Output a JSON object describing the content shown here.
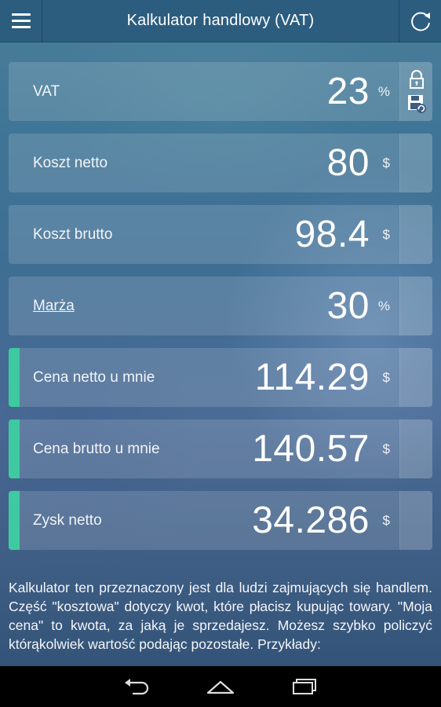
{
  "appbar": {
    "title": "Kalkulator handlowy (VAT)",
    "menu_icon": "hamburger-menu-icon",
    "refresh_icon": "refresh-icon"
  },
  "rows": [
    {
      "label": "VAT",
      "value": "23",
      "unit": "%",
      "accent": false,
      "link": false,
      "side_icons": [
        "lock-icon",
        "save-refresh-icon"
      ]
    },
    {
      "label": "Koszt netto",
      "value": "80",
      "unit": "$",
      "accent": false,
      "link": false
    },
    {
      "label": "Koszt brutto",
      "value": "98.4",
      "unit": "$",
      "accent": false,
      "link": false
    },
    {
      "label": "Marża",
      "value": "30",
      "unit": "%",
      "accent": false,
      "link": true
    },
    {
      "label": "Cena netto u mnie",
      "value": "114.29",
      "unit": "$",
      "accent": true,
      "link": false
    },
    {
      "label": "Cena brutto u mnie",
      "value": "140.57",
      "unit": "$",
      "accent": true,
      "link": false
    },
    {
      "label": "Zysk netto",
      "value": "34.286",
      "unit": "$",
      "accent": true,
      "link": false
    }
  ],
  "description": "Kalkulator ten przeznaczony jest dla ludzi zajmujących się handlem. Część \"kosztowa\" dotyczy kwot, które płacisz kupując towary. \"Moja cena\" to kwota, za jaką je sprzedajesz. Możesz szybko policzyć którąkolwiek wartość podając pozostałe. Przykłady:",
  "colors": {
    "accent": "#3fc9a0",
    "appbar": "#2c5d7f"
  },
  "navbar": {
    "icons": [
      "back-icon",
      "home-icon",
      "recent-apps-icon"
    ]
  }
}
